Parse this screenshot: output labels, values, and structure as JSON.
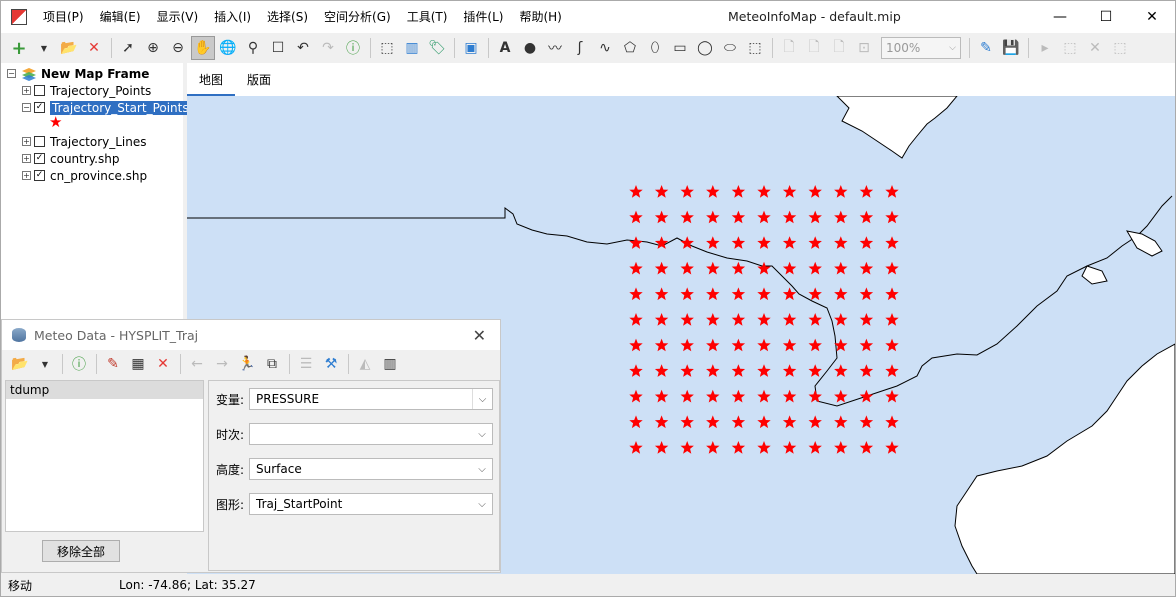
{
  "app": {
    "title": "MeteoInfoMap - default.mip",
    "menu": [
      "项目(P)",
      "编辑(E)",
      "显示(V)",
      "插入(I)",
      "选择(S)",
      "空间分析(G)",
      "工具(T)",
      "插件(L)",
      "帮助(H)"
    ],
    "window_controls": {
      "minimize": "—",
      "maximize": "☐",
      "close": "✕"
    }
  },
  "toolbar": {
    "zoom_level": "100%",
    "active_tool": "pan"
  },
  "layers": {
    "frame_name": "New Map Frame",
    "items": [
      {
        "label": "Trajectory_Points",
        "checked": false
      },
      {
        "label": "Trajectory_Start_Points",
        "checked": true,
        "selected": true
      },
      {
        "label": "Trajectory_Lines",
        "checked": false
      },
      {
        "label": "country.shp",
        "checked": true
      },
      {
        "label": "cn_province.shp",
        "checked": true
      }
    ],
    "legend_symbol": "★"
  },
  "map": {
    "tabs": [
      "地图",
      "版面"
    ],
    "active_tab": "地图",
    "background_color": "#cde0f6",
    "star_color": "#ff0000",
    "star_grid": {
      "rows": 11,
      "cols": 11
    }
  },
  "meteo_dialog": {
    "title": "Meteo Data - HYSPLIT_Traj",
    "files": [
      "tdump"
    ],
    "remove_all_label": "移除全部",
    "fields": {
      "variable": {
        "label": "变量:",
        "value": "PRESSURE"
      },
      "time": {
        "label": "时次:",
        "value": ""
      },
      "level": {
        "label": "高度:",
        "value": "Surface"
      },
      "graphic": {
        "label": "图形:",
        "value": "Traj_StartPoint"
      }
    }
  },
  "status": {
    "mode": "移动",
    "coords": "Lon: -74.86; Lat: 35.27"
  }
}
